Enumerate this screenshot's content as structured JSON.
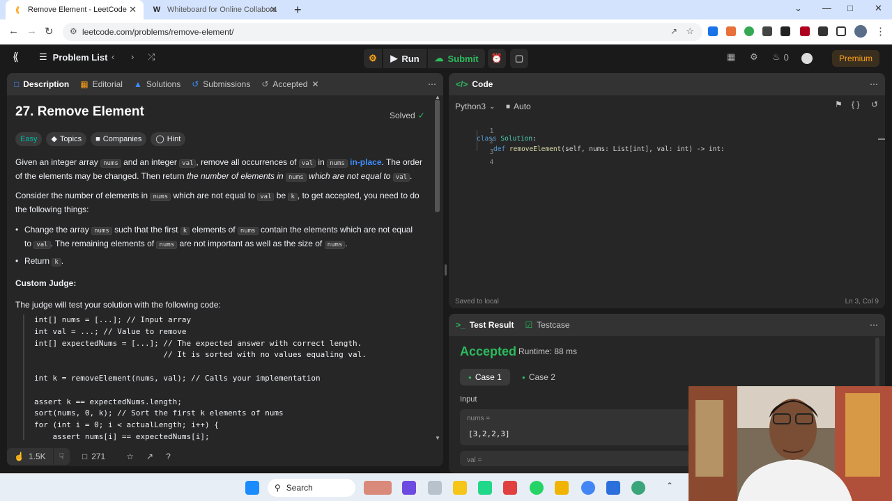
{
  "browser": {
    "tabs": [
      {
        "title": "Remove Element - LeetCode",
        "active": true
      },
      {
        "title": "Whiteboard for Online Collabora",
        "active": false
      }
    ],
    "url": "leetcode.com/problems/remove-element/"
  },
  "header": {
    "problem_list": "Problem List",
    "run": "Run",
    "submit": "Submit",
    "streak_count": "0",
    "premium": "Premium"
  },
  "left_panel": {
    "tabs": [
      "Description",
      "Editorial",
      "Solutions",
      "Submissions",
      "Accepted"
    ],
    "title": "27. Remove Element",
    "solved": "Solved",
    "tags": [
      "Easy",
      "Topics",
      "Companies",
      "Hint"
    ],
    "p1": {
      "a": "Given an integer array ",
      "c1": "nums",
      "b": " and an integer ",
      "c2": "val",
      "c": ", remove all occurrences of ",
      "c3": "val",
      "d": " in ",
      "c4": "nums",
      "link": "in-place",
      "e": ". The order of the elements may be changed. Then return ",
      "em": "the number of elements in ",
      "c5": "nums",
      "em2": " which are not equal to ",
      "c6": "val",
      "f": "."
    },
    "p2": {
      "a": "Consider the number of elements in ",
      "c1": "nums",
      "b": " which are not equal to ",
      "c2": "val",
      "c": " be ",
      "c3": "k",
      "d": ", to get accepted, you need to do the following things:"
    },
    "bullet1": {
      "a": "Change the array ",
      "c1": "nums",
      "b": " such that the first ",
      "c2": "k",
      "c": " elements of ",
      "c3": "nums",
      "d": " contain the elements which are not equal to ",
      "c4": "val",
      "e": ". The remaining elements of ",
      "c5": "nums",
      "f": " are not important as well as the size of ",
      "c6": "nums",
      "g": "."
    },
    "bullet2": {
      "a": "Return ",
      "c1": "k",
      "b": "."
    },
    "custom_judge": "Custom Judge:",
    "judge_text": "The judge will test your solution with the following code:",
    "code_block": "int[] nums = [...]; // Input array\nint val = ...; // Value to remove\nint[] expectedNums = [...]; // The expected answer with correct length.\n                            // It is sorted with no values equaling val.\n\nint k = removeElement(nums, val); // Calls your implementation\n\nassert k == expectedNums.length;\nsort(nums, 0, k); // Sort the first k elements of nums\nfor (int i = 0; i < actualLength; i++) {\n    assert nums[i] == expectedNums[i];",
    "footer": {
      "likes": "1.5K",
      "comments": "271"
    }
  },
  "code_panel": {
    "title": "Code",
    "language": "Python3",
    "auto": "Auto",
    "lines": [
      {
        "n": "1"
      },
      {
        "n": "2"
      },
      {
        "n": "3"
      },
      {
        "n": "4"
      }
    ],
    "code": {
      "l1_kw": "class",
      "l1_cls": "Solution",
      "l1_rest": ":",
      "l2_kw": "def",
      "l2_fn": "removeElement",
      "l2_rest": "(self, nums: List[int], val: int) -> int:"
    },
    "saved": "Saved to local",
    "cursor_pos": "Ln 3, Col 9"
  },
  "result_panel": {
    "tabs": [
      "Test Result",
      "Testcase"
    ],
    "status": "Accepted",
    "runtime": "Runtime: 88 ms",
    "cases": [
      "Case 1",
      "Case 2"
    ],
    "input_label": "Input",
    "var1_name": "nums =",
    "var1_value": "[3,2,2,3]",
    "var2_name": "val ="
  },
  "taskbar": {
    "search": "Search"
  },
  "colors": {
    "accent_orange": "#ffa116",
    "easy_teal": "#00b8a3",
    "accepted_green": "#2cbb5d",
    "link_blue": "#3c8cff"
  }
}
